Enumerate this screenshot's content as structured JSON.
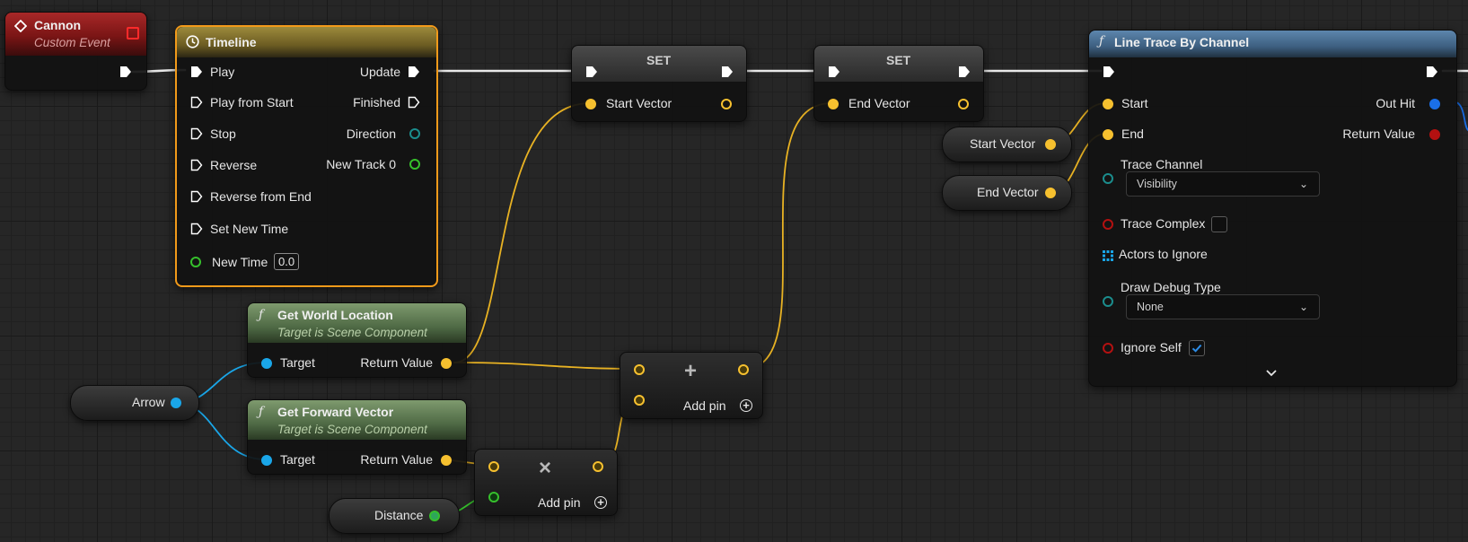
{
  "colors": {
    "exec": "#ffffff",
    "vector": "#f6c02f",
    "object": "#1aa6e8",
    "float": "#36c02c",
    "float_dark": "#2ea65b",
    "bool": "#b31111",
    "struct": "#1b8d8d"
  },
  "cannon": {
    "title": "Cannon",
    "subtitle": "Custom Event"
  },
  "timeline": {
    "title": "Timeline",
    "play": "Play",
    "play_from_start": "Play from Start",
    "stop": "Stop",
    "reverse": "Reverse",
    "reverse_from_end": "Reverse from End",
    "set_new_time": "Set New Time",
    "new_time": "New Time",
    "new_time_value": "0.0",
    "update": "Update",
    "finished": "Finished",
    "direction": "Direction",
    "new_track": "New Track 0"
  },
  "set1": {
    "title": "SET",
    "pin": "Start Vector"
  },
  "set2": {
    "title": "SET",
    "pin": "End Vector"
  },
  "get_world_location": {
    "title": "Get World Location",
    "subtitle": "Target is Scene Component",
    "target": "Target",
    "return": "Return Value"
  },
  "get_forward_vector": {
    "title": "Get Forward Vector",
    "subtitle": "Target is Scene Component",
    "target": "Target",
    "return": "Return Value"
  },
  "arrow": {
    "label": "Arrow"
  },
  "distance": {
    "label": "Distance"
  },
  "add_node": {
    "add_pin": "Add pin",
    "symbol": "+"
  },
  "multiply_node": {
    "add_pin": "Add pin",
    "symbol": "×"
  },
  "start_vector_getter": {
    "label": "Start Vector"
  },
  "end_vector_getter": {
    "label": "End Vector"
  },
  "line_trace": {
    "title": "Line Trace By Channel",
    "start": "Start",
    "end": "End",
    "trace_channel": "Trace Channel",
    "trace_channel_value": "Visibility",
    "trace_complex": "Trace Complex",
    "actors_to_ignore": "Actors to Ignore",
    "draw_debug_type": "Draw Debug Type",
    "draw_debug_value": "None",
    "ignore_self": "Ignore Self",
    "out_hit": "Out Hit",
    "return_value": "Return Value",
    "ignore_self_checked": true,
    "trace_complex_checked": false
  }
}
